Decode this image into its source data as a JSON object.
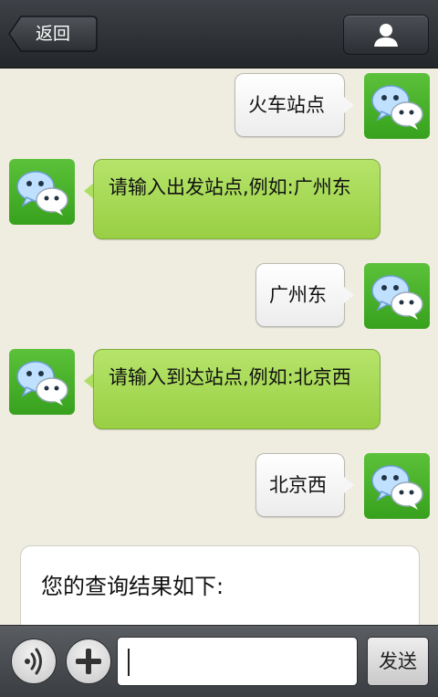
{
  "header": {
    "back_label": "返回",
    "profile_icon": "person-icon"
  },
  "messages": [
    {
      "direction": "out",
      "text": "火车站点"
    },
    {
      "direction": "in",
      "text": "请输入出发站点,例如:广州东"
    },
    {
      "direction": "out",
      "text": "广州东"
    },
    {
      "direction": "in",
      "text": "请输入到达站点,例如:北京西"
    },
    {
      "direction": "out",
      "text": "北京西"
    }
  ],
  "result_card": {
    "title": "您的查询结果如下:"
  },
  "composer": {
    "voice_icon": "voice-icon",
    "plus_icon": "plus-icon",
    "input_value": "",
    "send_label": "发送"
  },
  "colors": {
    "background": "#efece0",
    "incoming_bubble": "#a9da5a",
    "avatar_green": "#44aa22"
  }
}
